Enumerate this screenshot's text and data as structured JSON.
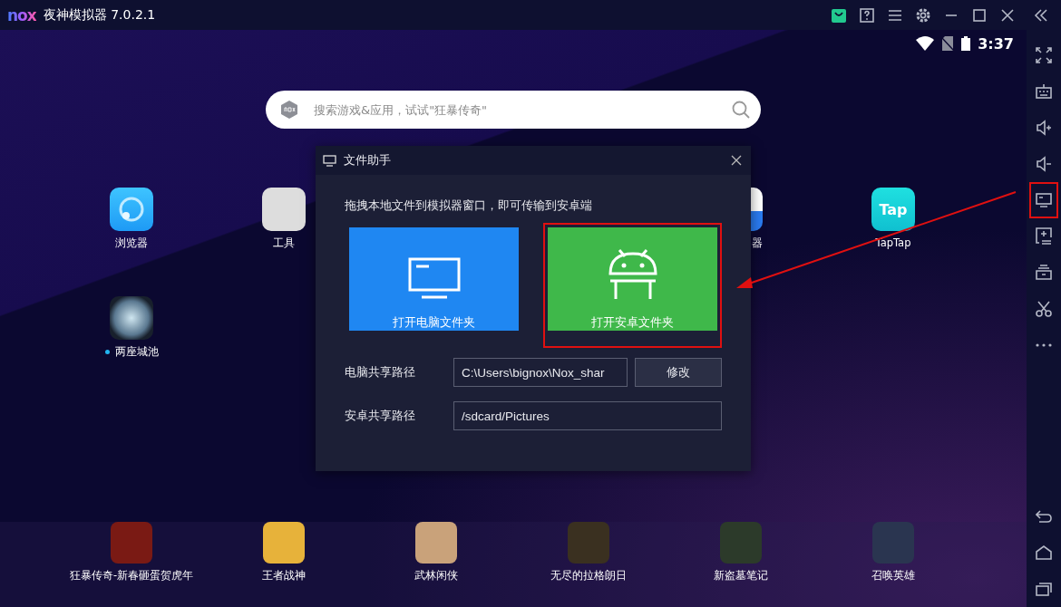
{
  "window": {
    "logo": "nox",
    "title": "夜神模拟器 7.0.2.1",
    "controls": [
      {
        "kind": "store"
      },
      {
        "kind": "help"
      },
      {
        "kind": "menu"
      },
      {
        "kind": "settings"
      },
      {
        "kind": "minimize"
      },
      {
        "kind": "maximize"
      },
      {
        "kind": "close"
      },
      {
        "kind": "collapse"
      }
    ]
  },
  "status_bar": {
    "time": "3:37"
  },
  "search": {
    "placeholder": "搜索游戏&应用，试试\"狂暴传奇\""
  },
  "desktop": {
    "apps": [
      {
        "label": "浏览器",
        "kind": "browser",
        "new": false
      },
      {
        "label": "工具",
        "kind": "tools",
        "new": false
      },
      {
        "label": "器",
        "kind": "partial",
        "new": false
      },
      {
        "label": "TapTap",
        "kind": "taptap",
        "icon_text": "Tap",
        "new": false
      },
      {
        "label": "两座城池",
        "kind": "game",
        "new": true
      }
    ]
  },
  "dialog": {
    "title": "文件助手",
    "hint": "拖拽本地文件到模拟器窗口，即可传输到安卓端",
    "buttons": [
      {
        "label": "打开电脑文件夹",
        "kind": "computer",
        "highlighted": false
      },
      {
        "label": "打开安卓文件夹",
        "kind": "android",
        "highlighted": true
      }
    ],
    "pc_path": {
      "label": "电脑共享路径",
      "value": "C:\\Users\\bignox\\Nox_shar",
      "button": "修改"
    },
    "android_path": {
      "label": "安卓共享路径",
      "value": "/sdcard/Pictures"
    }
  },
  "dock": [
    {
      "label": "狂暴传奇-新春砸蛋贺虎年"
    },
    {
      "label": "王者战神"
    },
    {
      "label": "武林闲侠"
    },
    {
      "label": "无尽的拉格朗日"
    },
    {
      "label": "新盗墓笔记"
    },
    {
      "label": "召唤英雄"
    }
  ],
  "sidebar": {
    "items": [
      {
        "kind": "fullscreen",
        "highlighted": false
      },
      {
        "kind": "keyboard",
        "highlighted": false
      },
      {
        "kind": "volume-up",
        "highlighted": false
      },
      {
        "kind": "volume-down",
        "highlighted": false
      },
      {
        "kind": "screen",
        "highlighted": true
      },
      {
        "kind": "apk",
        "highlighted": false
      },
      {
        "kind": "toolbox",
        "highlighted": false
      },
      {
        "kind": "scissors",
        "highlighted": false
      },
      {
        "kind": "more",
        "highlighted": false
      }
    ],
    "nav": [
      {
        "kind": "back"
      },
      {
        "kind": "home"
      },
      {
        "kind": "recents"
      }
    ]
  }
}
